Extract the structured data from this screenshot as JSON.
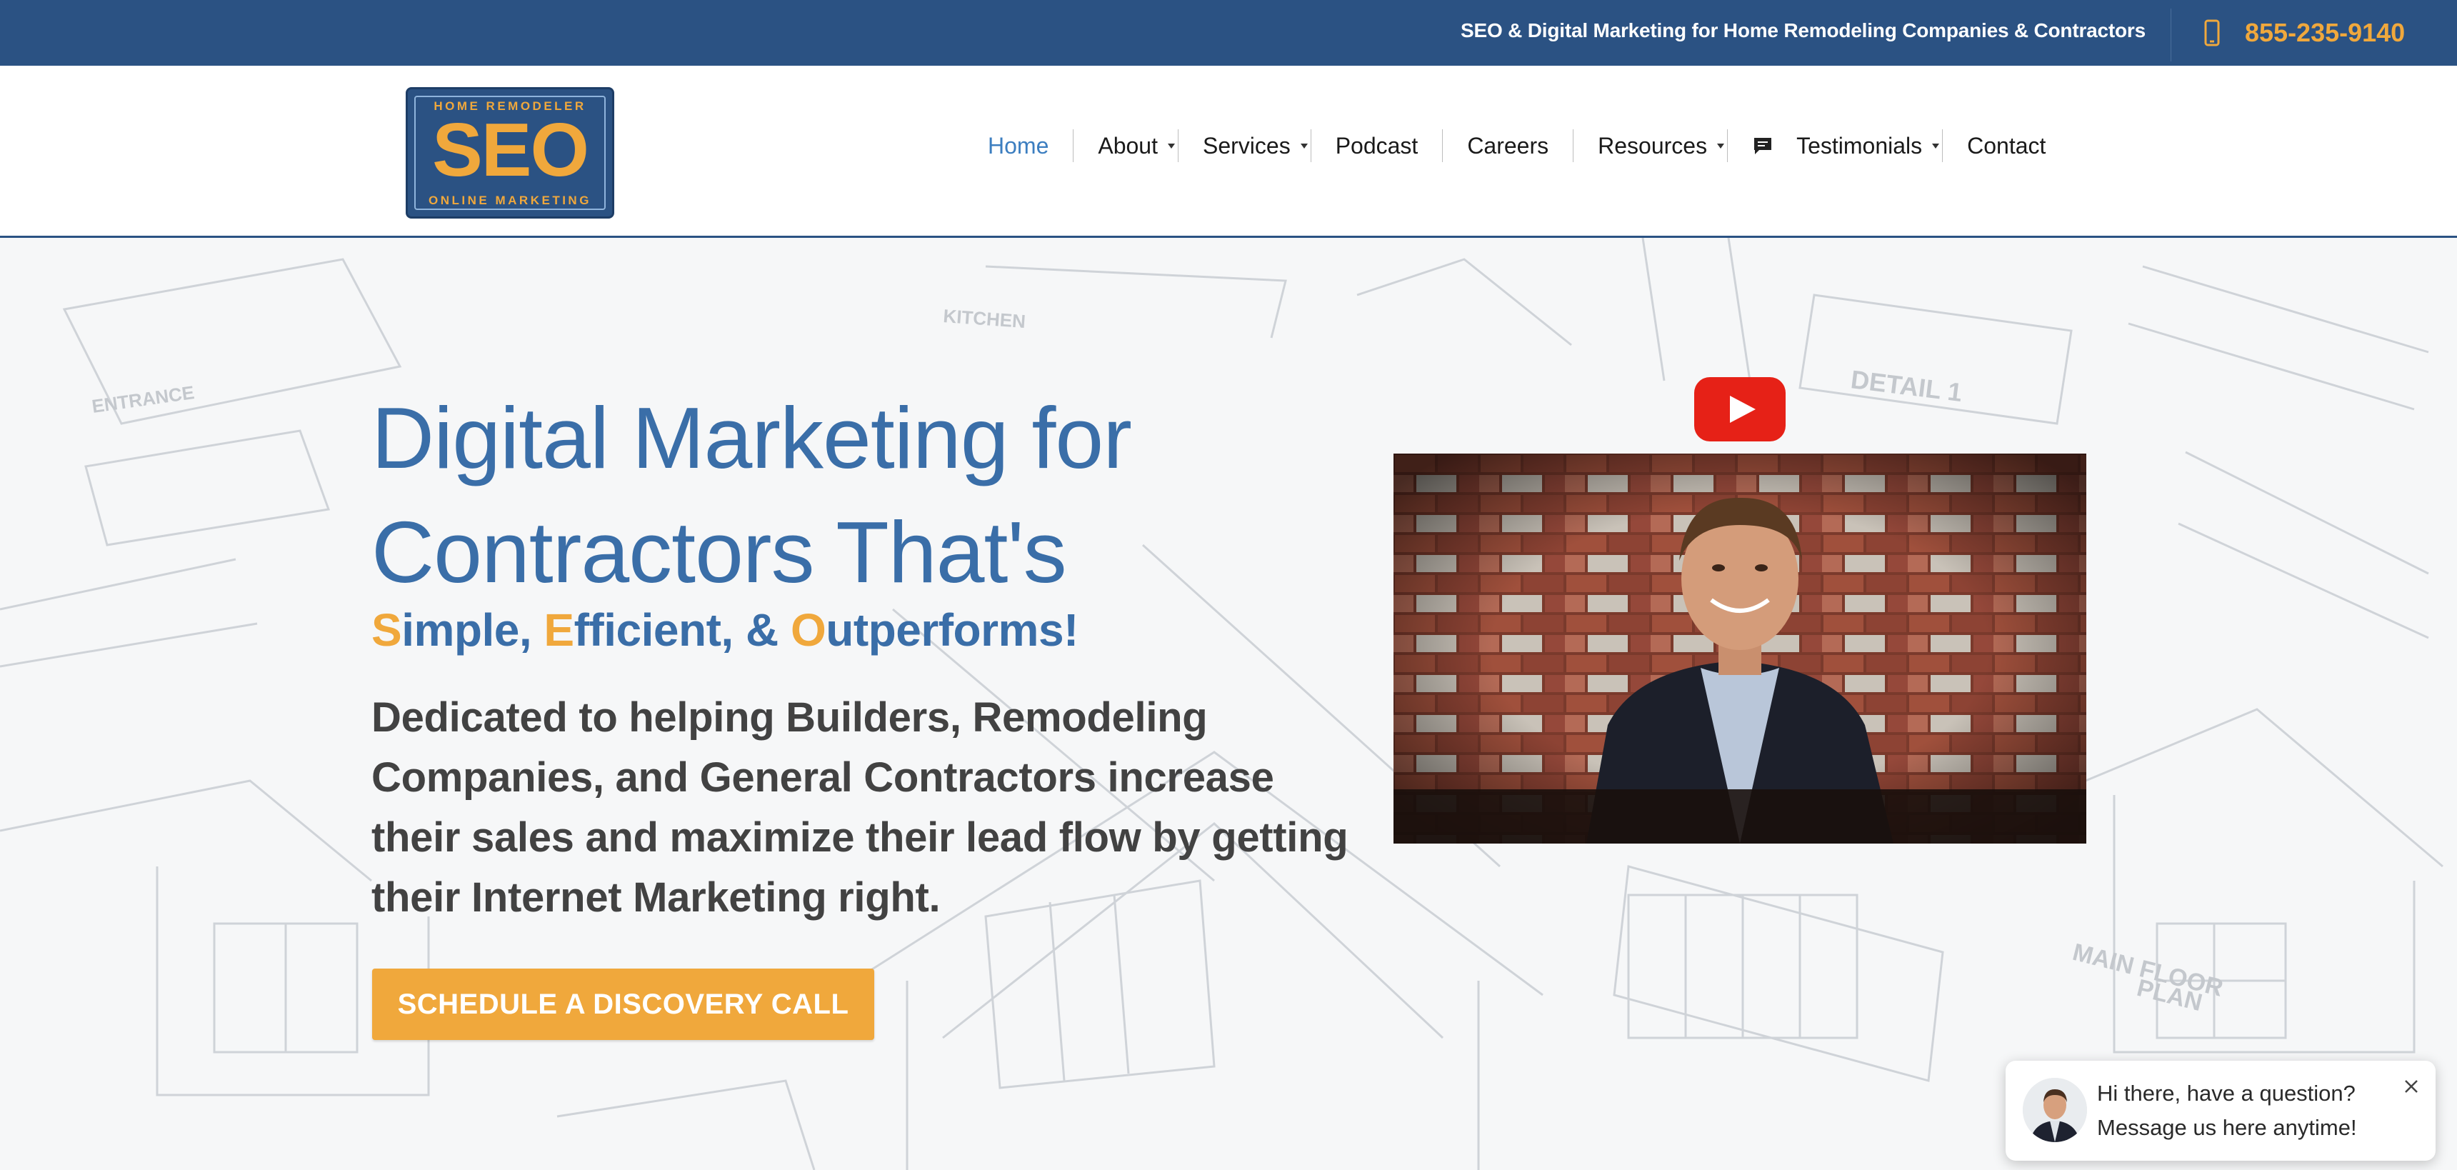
{
  "topbar": {
    "tagline": "SEO & Digital Marketing for Home Remodeling Companies & Contractors",
    "phone": "855-235-9140",
    "phone_icon": "mobile-phone-icon"
  },
  "logo": {
    "top_text": "HOME REMODELER",
    "main_text": "SEO",
    "bottom_text": "ONLINE MARKETING"
  },
  "nav": {
    "home": "Home",
    "about": "About",
    "services": "Services",
    "podcast": "Podcast",
    "careers": "Careers",
    "resources": "Resources",
    "testimonials": "Testimonials",
    "testimonials_icon": "chat-bubble-icon",
    "contact": "Contact"
  },
  "hero": {
    "title_line1": "Digital Marketing for",
    "title_line2": "Contractors That's",
    "sub_s": "S",
    "sub_imple": "imple, ",
    "sub_e": "E",
    "sub_fficient": "fficient, & ",
    "sub_o": "O",
    "sub_utperforms": "utperforms!",
    "description": "Dedicated to helping Builders, Remodeling Companies, and General Contractors increase their sales and maximize their lead flow by getting their Internet Marketing right.",
    "cta_label": "SCHEDULE A DISCOVERY CALL"
  },
  "video": {
    "play_icon": "youtube-play-icon"
  },
  "chat": {
    "line1": "Hi there, have a question?",
    "line2": "Message us here anytime!",
    "close_icon": "close-icon"
  },
  "colors": {
    "brand_blue": "#2b5283",
    "accent_orange": "#f0a83c",
    "heading_blue": "#3a6ea8",
    "link_active": "#3c7ec0"
  }
}
